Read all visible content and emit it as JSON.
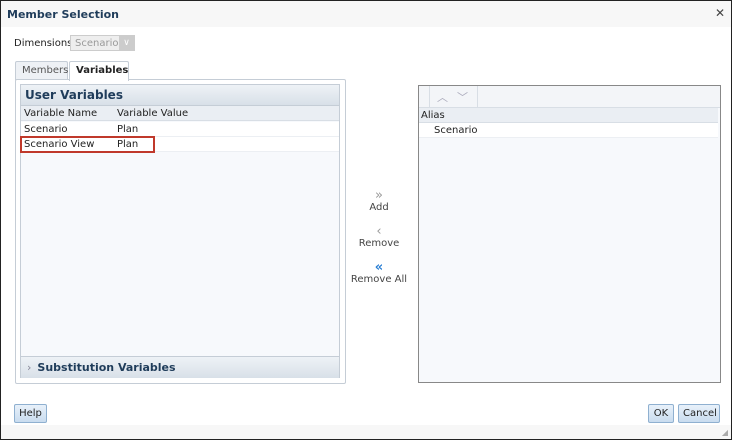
{
  "dialog": {
    "title": "Member Selection"
  },
  "dimensions": {
    "label": "Dimensions",
    "value": "Scenario"
  },
  "tabs": [
    {
      "label": "Members",
      "active": false
    },
    {
      "label": "Variables",
      "active": true
    }
  ],
  "user_variables": {
    "title": "User Variables",
    "columns": [
      "Variable Name",
      "Variable Value"
    ],
    "rows": [
      {
        "name": "Scenario",
        "value": "Plan"
      },
      {
        "name": "Scenario View",
        "value": "Plan",
        "highlighted": true
      }
    ]
  },
  "substitution_variables": {
    "title": "Substitution Variables"
  },
  "actions": {
    "add": "Add",
    "remove": "Remove",
    "remove_all": "Remove All"
  },
  "selection": {
    "column": "Alias",
    "rows": [
      "Scenario"
    ]
  },
  "footer": {
    "help": "Help",
    "ok": "OK",
    "cancel": "Cancel"
  },
  "colors": {
    "highlight": "#c0392b",
    "title": "#1f3c5a"
  }
}
